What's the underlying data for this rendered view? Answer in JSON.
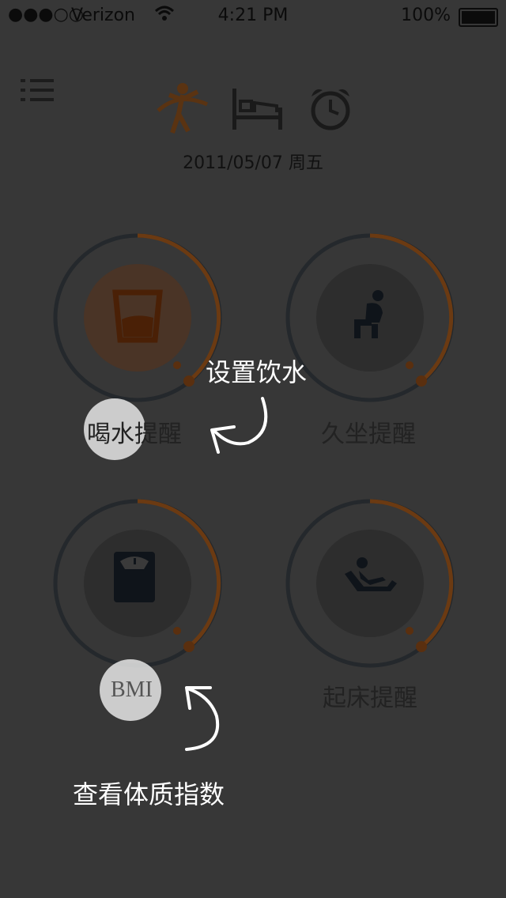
{
  "status_bar": {
    "signal": "●●●○○",
    "carrier": "Verizon",
    "time": "4:21 PM",
    "battery": "100%"
  },
  "top_icons": [
    "runner-icon",
    "bed-icon",
    "alarm-clock-icon"
  ],
  "date": "2011/05/07 周五",
  "cards": [
    {
      "label": "喝水提醒",
      "icon": "water-glass-icon"
    },
    {
      "label": "久坐提醒",
      "icon": "sitting-person-icon"
    },
    {
      "label": "BMI",
      "icon": "scale-icon"
    },
    {
      "label": "起床提醒",
      "icon": "reclining-person-icon"
    }
  ],
  "callouts": {
    "water": "设置饮水",
    "bmi": "查看体质指数"
  },
  "colors": {
    "background": "#373737",
    "ring_orange": "#6b3a12",
    "ring_dark": "#24282c",
    "inner_circle": "#2d2d2d",
    "water_inner": "#4a3426"
  }
}
